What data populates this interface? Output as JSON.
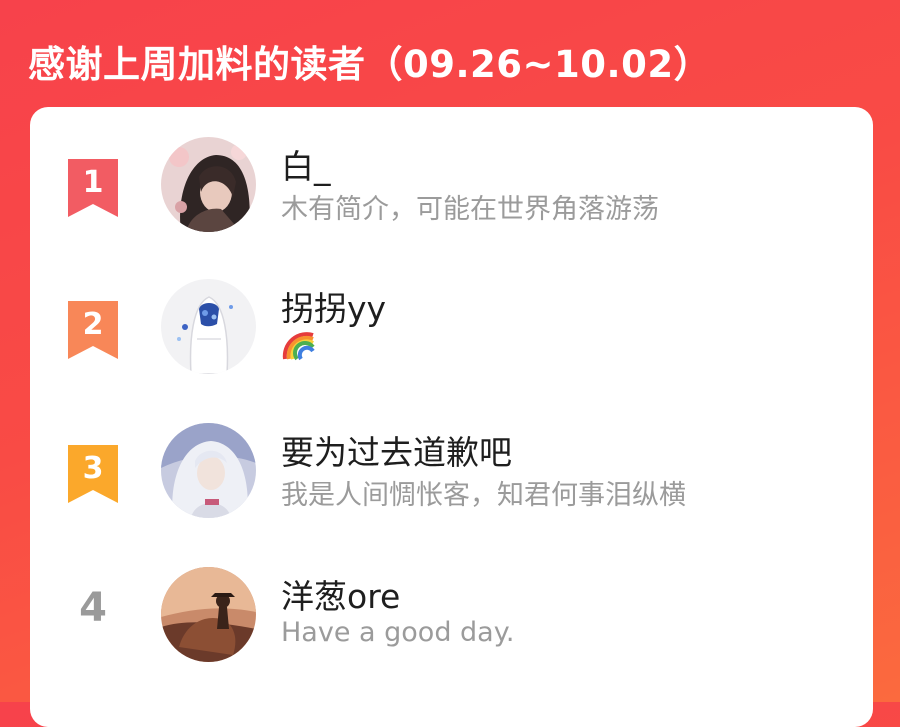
{
  "header": {
    "title": "感谢上周加料的读者（09.26~10.02）"
  },
  "colors": {
    "background_start": "#f7424b",
    "background_end": "#fb6a3e",
    "rank_1": "#f25c63",
    "rank_2": "#f88758",
    "rank_3": "#fba82b",
    "rank_plain": "#9a9a9a",
    "name_text": "#1e1e1e",
    "bio_text": "#9b9b9b"
  },
  "readers": [
    {
      "rank": "1",
      "name": "白_",
      "bio": "木有简介，可能在世界角落游荡",
      "avatar_icon": "avatar-dark-hair-girl"
    },
    {
      "rank": "2",
      "name": "拐拐yy",
      "bio": "",
      "bio_icon": "rainbow-emoji",
      "avatar_icon": "avatar-hooded-figure"
    },
    {
      "rank": "3",
      "name": "要为过去道歉吧",
      "bio": "我是人间惆怅客，知君何事泪纵横",
      "avatar_icon": "avatar-silver-hair-character"
    },
    {
      "rank": "4",
      "name": "洋葱ore",
      "bio": "Have a good day.",
      "avatar_icon": "avatar-cowboy-horse"
    }
  ]
}
